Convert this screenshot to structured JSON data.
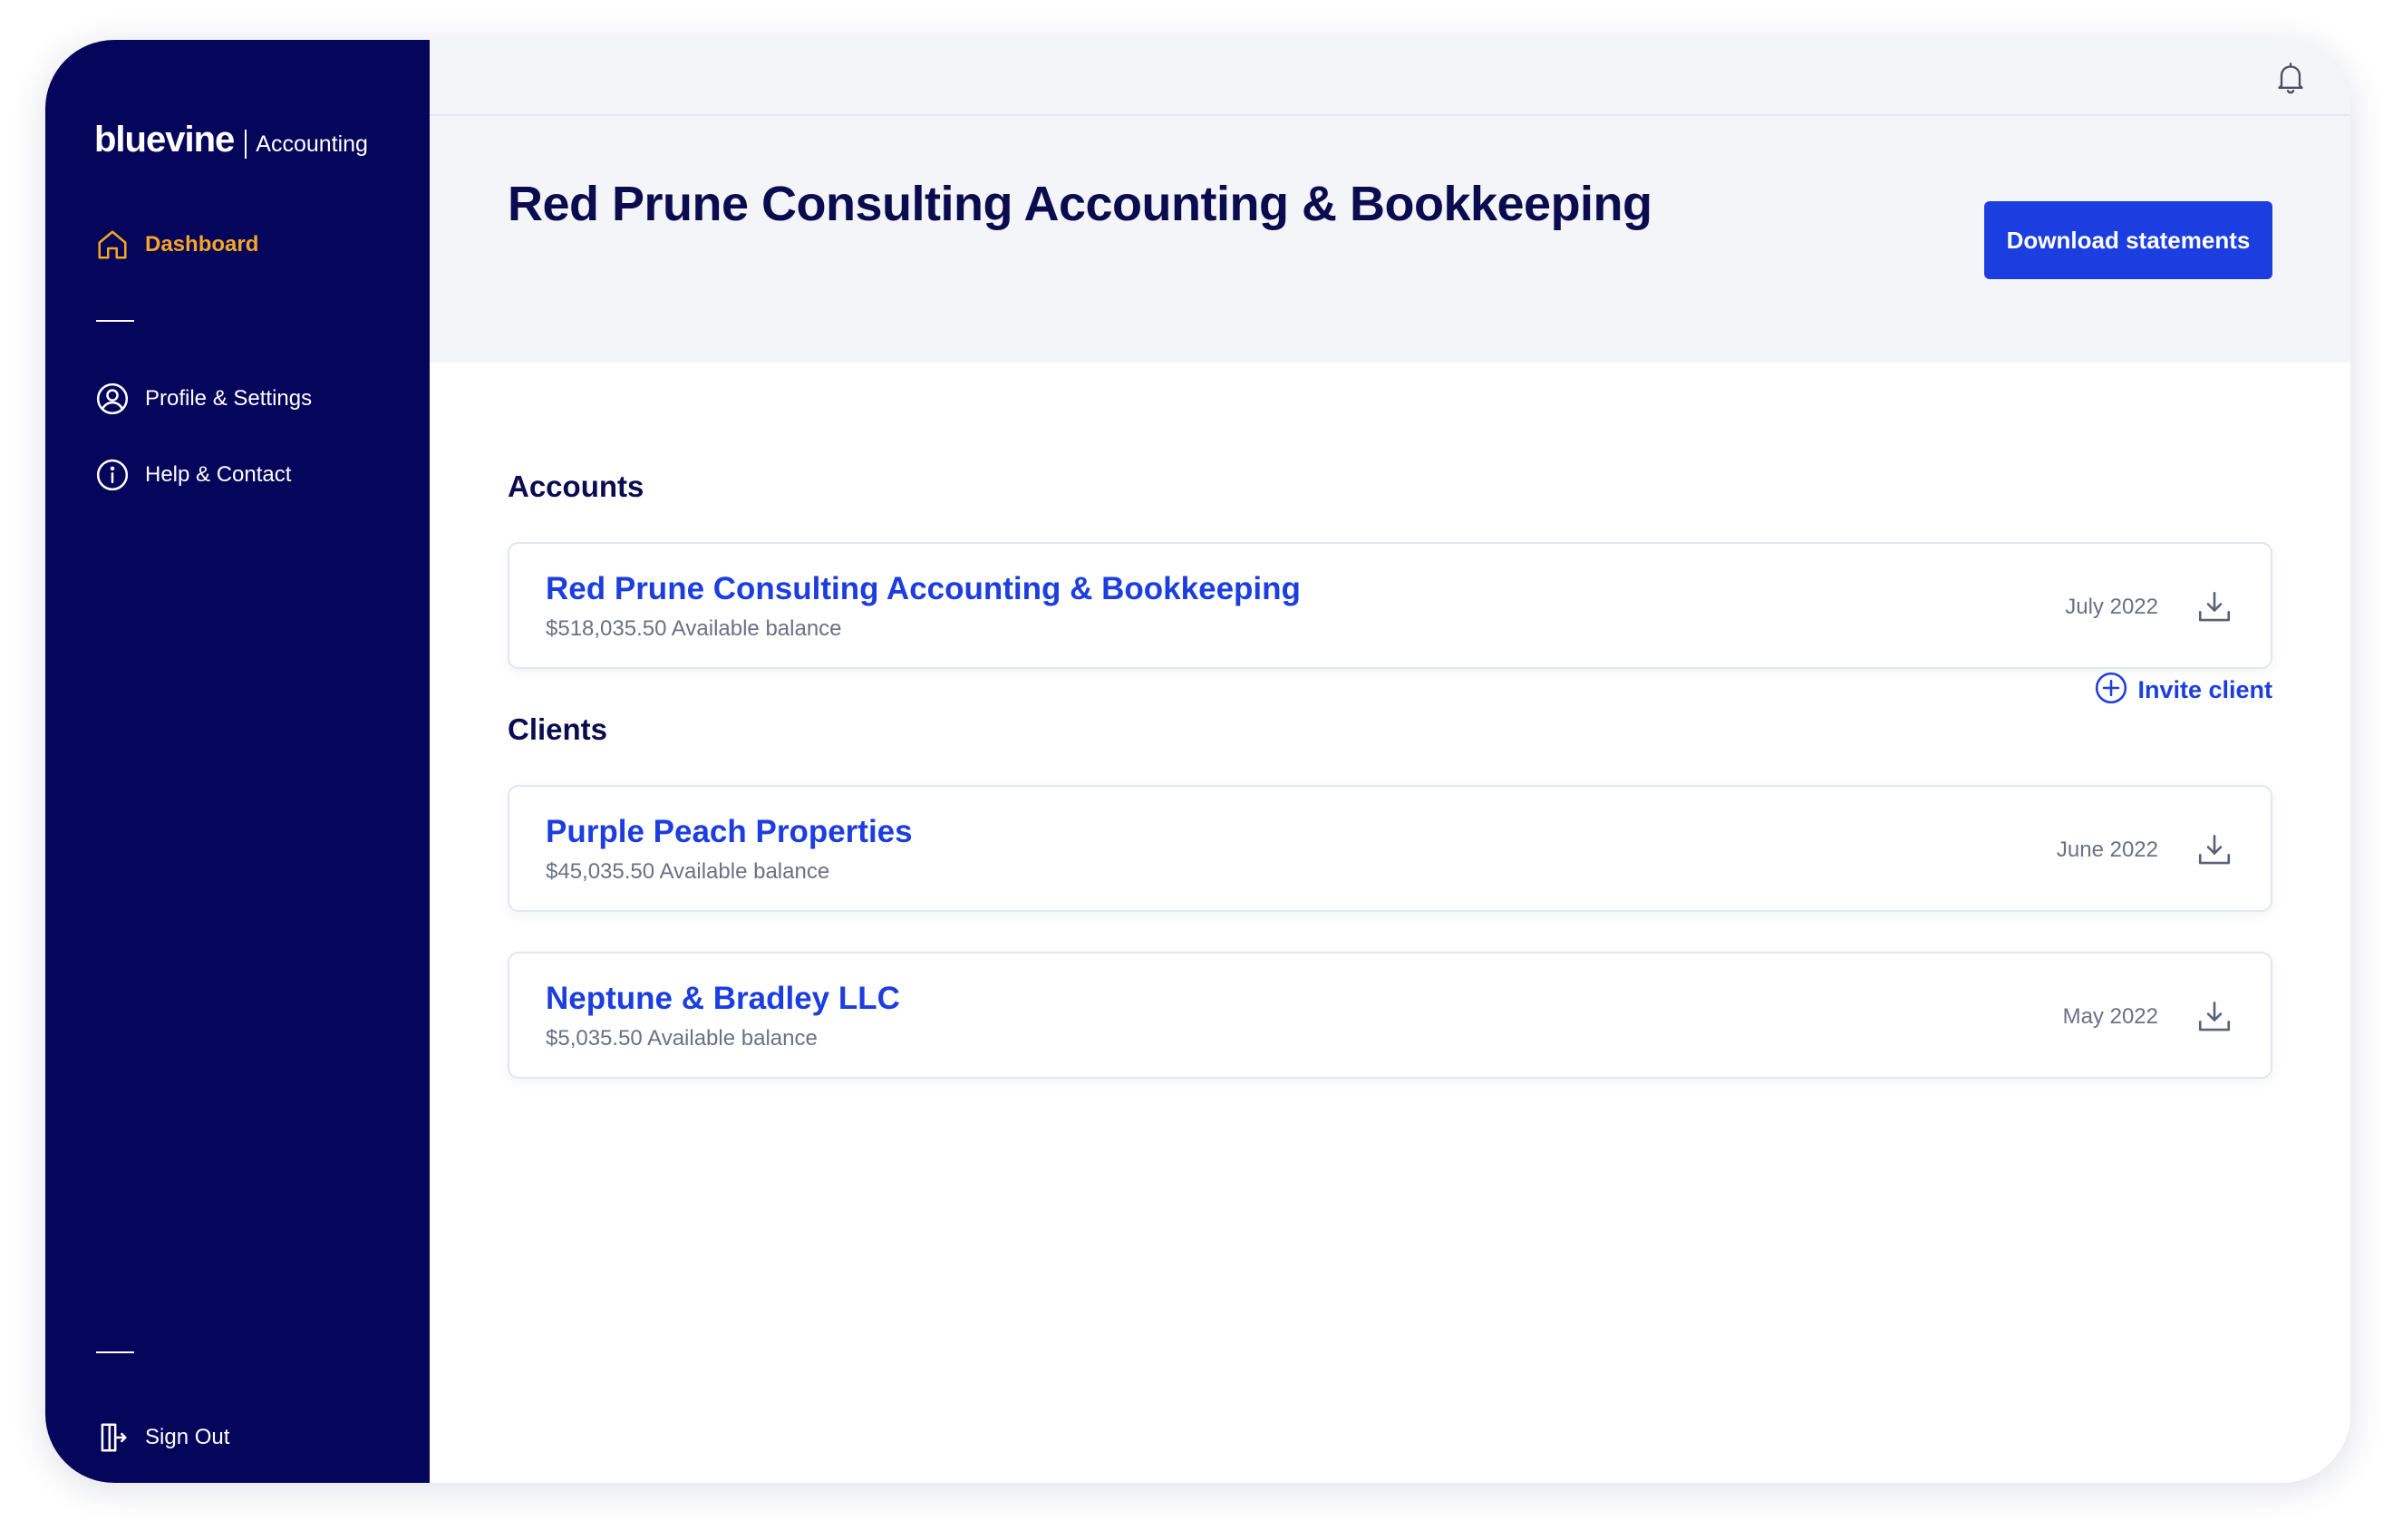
{
  "brand": {
    "name": "bluevine",
    "product": "Accounting"
  },
  "sidebar": {
    "items": [
      {
        "label": "Dashboard",
        "icon": "home-icon",
        "active": true
      },
      {
        "label": "Profile & Settings",
        "icon": "user-circle-icon"
      },
      {
        "label": "Help & Contact",
        "icon": "info-circle-icon"
      }
    ],
    "sign_out": {
      "label": "Sign Out",
      "icon": "sign-out-icon"
    }
  },
  "header": {
    "title": "Red Prune Consulting Accounting & Bookkeeping",
    "download_label": "Download statements"
  },
  "accounts": {
    "title": "Accounts",
    "items": [
      {
        "name": "Red Prune Consulting Accounting & Bookkeeping",
        "balance": "$518,035.50 Available balance",
        "date": "July 2022"
      }
    ]
  },
  "clients": {
    "title": "Clients",
    "invite_label": "Invite client",
    "items": [
      {
        "name": "Purple Peach Properties",
        "balance": "$45,035.50 Available balance",
        "date": "June 2022"
      },
      {
        "name": "Neptune & Bradley LLC",
        "balance": "$5,035.50 Available balance",
        "date": "May 2022"
      }
    ]
  },
  "colors": {
    "sidebar_bg": "#05055b",
    "accent": "#1c3ee0",
    "active": "#f5a623",
    "title": "#0b0b4f"
  }
}
